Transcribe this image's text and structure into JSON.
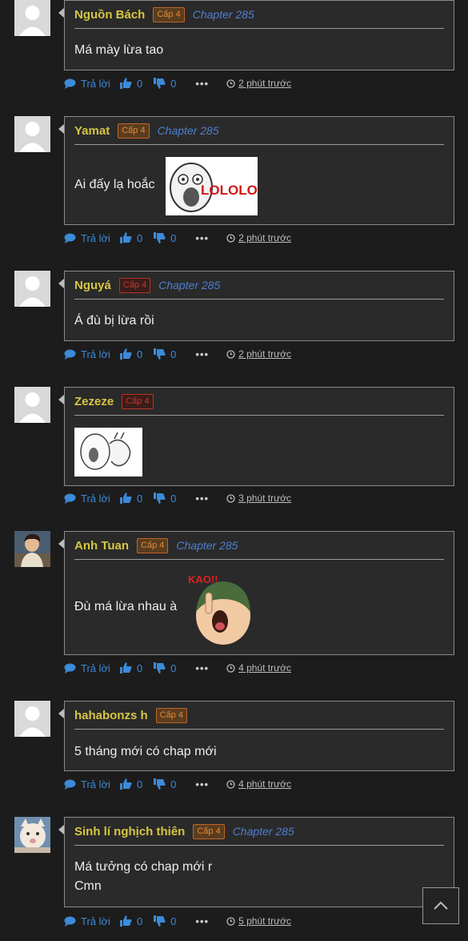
{
  "comments": [
    {
      "user": "Nguồn Bách",
      "level": "Cấp 4",
      "chapter": "Chapter 285",
      "text": "Má mày lừa tao",
      "reply": "Trả lời",
      "likes": "0",
      "dislikes": "0",
      "time": "2 phút trước"
    },
    {
      "user": "Yamat",
      "level": "Cấp 4",
      "chapter": "Chapter 285",
      "text": "Ai đấy lạ hoắc",
      "sticker_text": "LOLOLOL",
      "reply": "Trả lời",
      "likes": "0",
      "dislikes": "0",
      "time": "2 phút trước"
    },
    {
      "user": "Nguyá",
      "level": "Cấp 4",
      "chapter": "Chapter 285",
      "text": "Á đù bị lừa rồi",
      "reply": "Trả lời",
      "likes": "0",
      "dislikes": "0",
      "time": "2 phút trước"
    },
    {
      "user": "Zezeze",
      "level": "Cấp 4",
      "chapter": "",
      "text": "",
      "reply": "Trả lời",
      "likes": "0",
      "dislikes": "0",
      "time": "3 phút trước"
    },
    {
      "user": "Anh Tuan",
      "level": "Cấp 4",
      "chapter": "Chapter 285",
      "text": "Đù má lừa nhau à",
      "sticker_text": "KAO!!",
      "reply": "Trả lời",
      "likes": "0",
      "dislikes": "0",
      "time": "4 phút trước"
    },
    {
      "user": "hahabonzs h",
      "level": "Cấp 4",
      "chapter": "",
      "text": "5 tháng mới có chap mới",
      "reply": "Trả lời",
      "likes": "0",
      "dislikes": "0",
      "time": "4 phút trước"
    },
    {
      "user": "Sinh lí nghịch thiên",
      "level": "Cấp 4",
      "chapter": "Chapter 285",
      "text_line1": "Má tưởng có chap mới r",
      "text_line2": "Cmn",
      "reply": "Trả lời",
      "likes": "0",
      "dislikes": "0",
      "time": "5 phút trước"
    }
  ],
  "colors": {
    "username": "#d6c542",
    "chapter": "#4f7fd0",
    "action": "#3c8ad8"
  }
}
